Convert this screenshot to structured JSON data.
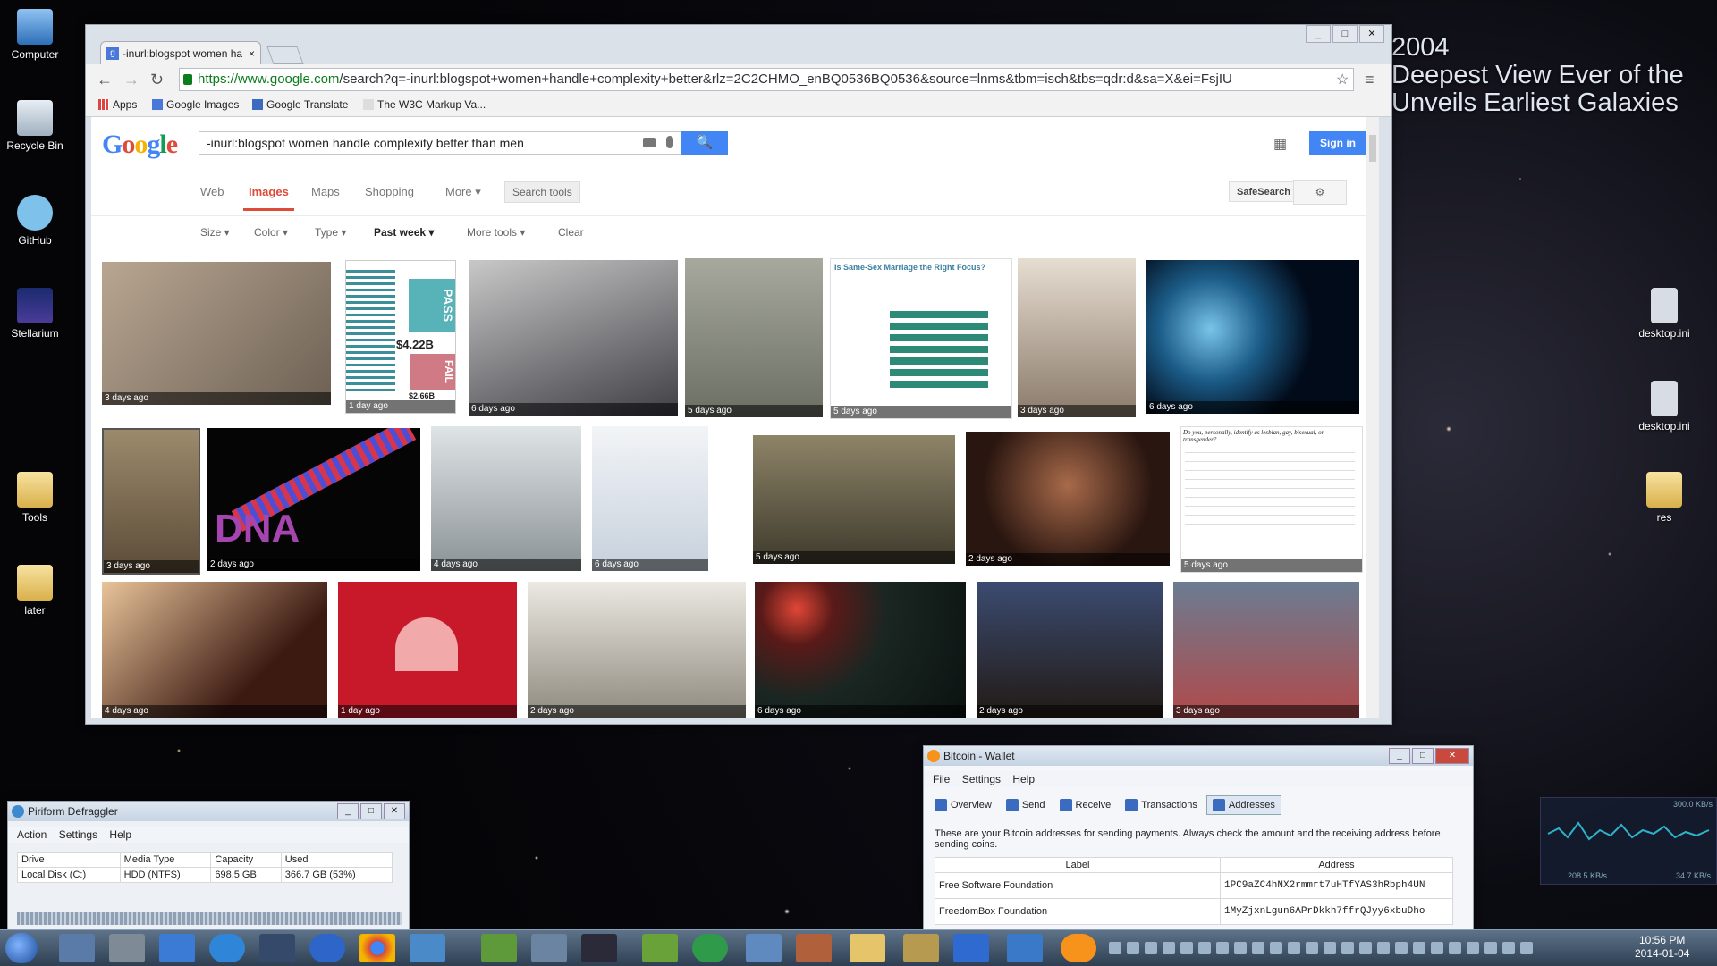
{
  "desktop": {
    "icons_left": [
      "Computer",
      "Recycle Bin",
      "GitHub",
      "Stellarium",
      "Tools",
      "later"
    ],
    "icons_right": [
      "desktop.ini",
      "desktop.ini",
      "res"
    ],
    "wallpaper_text": [
      "2004",
      "Deepest View Ever of the",
      "Unveils Earliest Galaxies"
    ]
  },
  "chrome": {
    "tab_title": "-inurl:blogspot women ha",
    "tab_close": "×",
    "url_scheme": "https://www.google.com",
    "url_rest": "/search?q=-inurl:blogspot+women+handle+complexity+better&rlz=2C2CHMO_enBQ0536BQ0536&source=lnms&tbm=isch&tbs=qdr:d&sa=X&ei=FsjIU",
    "bookmarks": [
      "Apps",
      "Google Images",
      "Google Translate",
      "The W3C Markup Va..."
    ],
    "window_buttons": [
      "_",
      "□",
      "✕"
    ],
    "nav_buttons": [
      "←",
      "→",
      "↻"
    ],
    "menu_icon": "≡",
    "star_icon": "☆"
  },
  "google": {
    "logo": "Google",
    "query": "-inurl:blogspot women handle complexity better than men",
    "search_icon": "🔍",
    "sign_in": "Sign in",
    "tabs": [
      "Web",
      "Images",
      "Maps",
      "Shopping",
      "More ▾"
    ],
    "search_tools": "Search tools",
    "safesearch": "SafeSearch ▾",
    "gear": "⚙",
    "filters": [
      "Size ▾",
      "Color ▾",
      "Type ▾",
      "Past week ▾",
      "More tools ▾",
      "Clear"
    ],
    "results_row1": [
      "3 days ago",
      "1 day ago",
      "6 days ago",
      "5 days ago",
      "5 days ago",
      "3 days ago",
      "6 days ago"
    ],
    "results_row2": [
      "3 days ago",
      "2 days ago",
      "4 days ago",
      "6 days ago",
      "5 days ago",
      "2 days ago",
      "5 days ago"
    ],
    "results_row3": [
      "4 days ago",
      "1 day ago",
      "2 days ago",
      "6 days ago",
      "2 days ago",
      "3 days ago"
    ],
    "img_text": {
      "pass": "PASS",
      "fail": "FAIL",
      "amount1": "$4.22B",
      "amount2": "$2.66B",
      "chart_title": "Is Same-Sex Marriage the Right Focus?",
      "dna": "DNA",
      "poll_title": "Do you, personally, identify as lesbian, gay, bisexual, or transgender?"
    }
  },
  "defraggler": {
    "title": "Piriform Defraggler",
    "menu": [
      "Action",
      "Settings",
      "Help"
    ],
    "columns": [
      "Drive",
      "Media Type",
      "Capacity",
      "Used"
    ],
    "row": [
      "Local Disk (C:)",
      "HDD (NTFS)",
      "698.5 GB",
      "366.7 GB (53%)"
    ]
  },
  "bitcoin": {
    "title": "Bitcoin - Wallet",
    "menu": [
      "File",
      "Settings",
      "Help"
    ],
    "toolbar": [
      "Overview",
      "Send",
      "Receive",
      "Transactions",
      "Addresses"
    ],
    "info": "These are your Bitcoin addresses for sending payments. Always check the amount and the receiving address before sending coins.",
    "columns": [
      "Label",
      "Address"
    ],
    "rows": [
      [
        "Free Software Foundation",
        "1PC9aZC4hNX2rmmrt7uHTfYAS3hRbph4UN"
      ],
      [
        "FreedomBox Foundation",
        "1MyZjxnLgun6APrDkkh7ffrQJyy6xbuDho"
      ]
    ]
  },
  "network_gadget": {
    "peak": "300.0 KB/s",
    "down": "208.5 KB/s",
    "up": "34.7 KB/s"
  },
  "taskbar": {
    "time": "10:56 PM",
    "date": "2014-01-04"
  }
}
